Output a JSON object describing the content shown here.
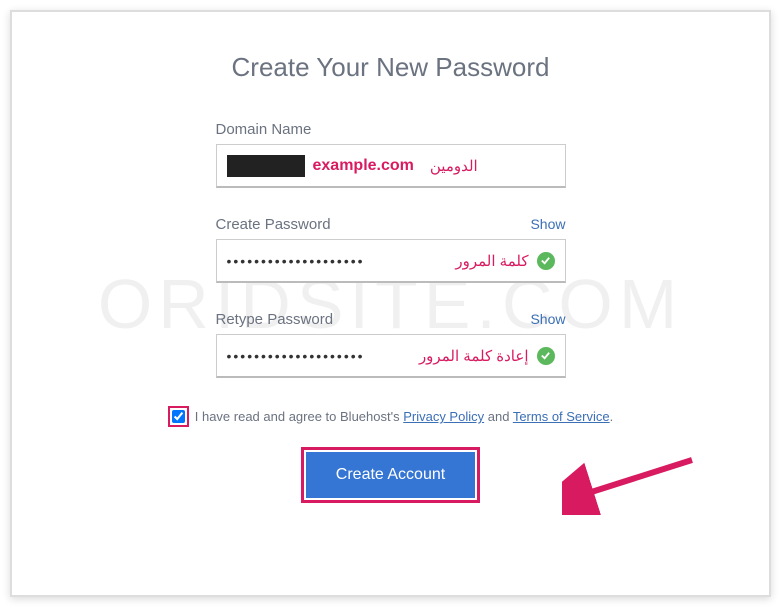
{
  "watermark": "ORIDSITE.COM",
  "title": "Create Your New Password",
  "domain": {
    "label": "Domain Name",
    "value": "example.com",
    "annotation_ar": "الدومين"
  },
  "password": {
    "label": "Create Password",
    "show": "Show",
    "masked": "••••••••••••••••••••",
    "annotation_ar": "كلمة المرور"
  },
  "retype": {
    "label": "Retype Password",
    "show": "Show",
    "masked": "••••••••••••••••••••",
    "annotation_ar": "إعادة كلمة المرور"
  },
  "agree": {
    "prefix": "I have read and agree to Bluehost's ",
    "privacy": "Privacy Policy",
    "mid": " and ",
    "terms": "Terms of Service",
    "suffix": "."
  },
  "button": "Create Account"
}
